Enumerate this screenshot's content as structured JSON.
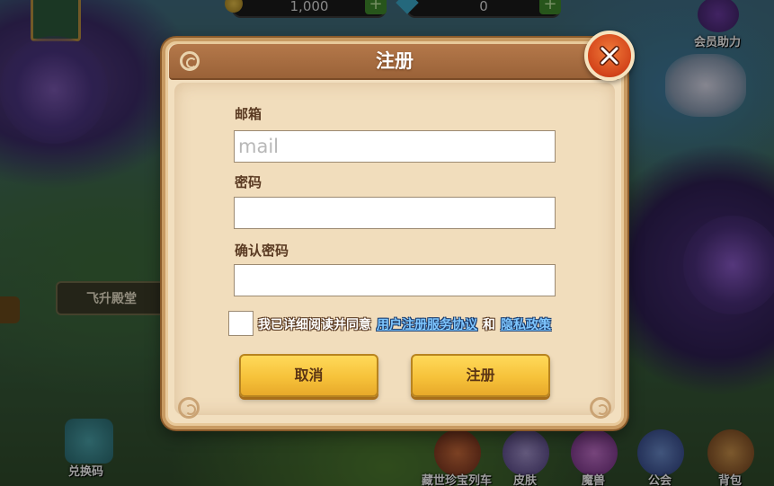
{
  "background": {
    "coin_value": "1,000",
    "gem_value": "0",
    "member_assist_label": "会员助力",
    "ascend_hall_label": "飞升殿堂",
    "redeem_code_label": "兑换码",
    "bottom_nav": [
      {
        "label": "藏世珍宝列车",
        "icon": "treasure-train-icon",
        "color": "#8a4a2a"
      },
      {
        "label": "皮肤",
        "icon": "skin-icon",
        "color": "#6a5a8a"
      },
      {
        "label": "魔兽",
        "icon": "beast-icon",
        "color": "#8a3a8a"
      },
      {
        "label": "公会",
        "icon": "guild-icon",
        "color": "#3a5a8a"
      },
      {
        "label": "背包",
        "icon": "backpack-icon",
        "color": "#7a4a1a"
      }
    ]
  },
  "dialog": {
    "title": "注册",
    "email_label": "邮箱",
    "email_placeholder": "mail",
    "email_value": "",
    "password_label": "密码",
    "password_value": "",
    "confirm_password_label": "确认密码",
    "confirm_password_value": "",
    "agree_checked": false,
    "agree_text": "我已详细阅读并同意",
    "terms_link": "用户注册服务协议",
    "and_text": "和",
    "privacy_link": "隐私政策",
    "cancel_label": "取消",
    "register_label": "注册"
  },
  "colors": {
    "dialog_bg": "#f2dfbf",
    "header_bg": "#a86e42",
    "button_yellow": "#f6c23a",
    "close_red": "#d3441a",
    "link_blue": "#7ec6ff"
  }
}
